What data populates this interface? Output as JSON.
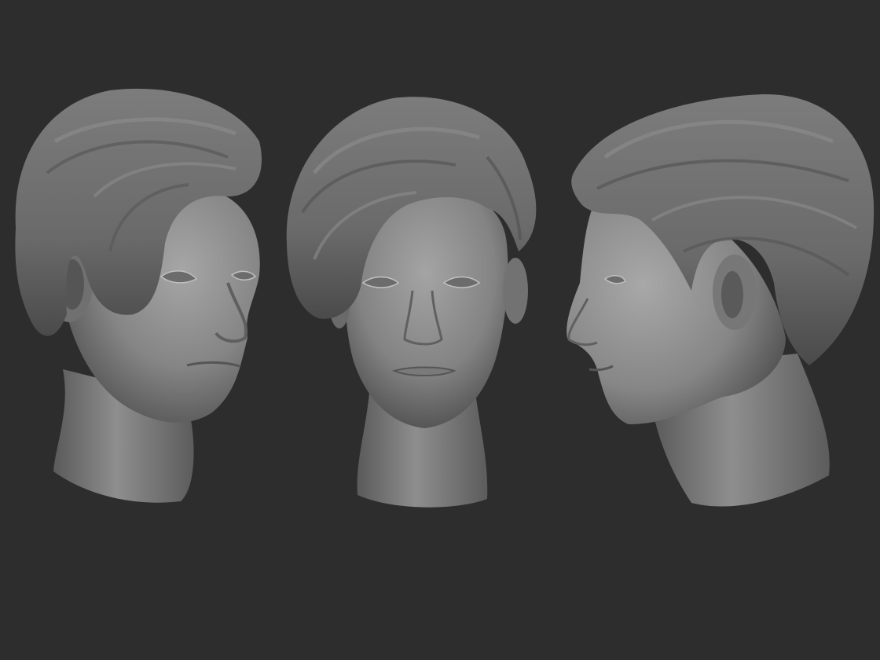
{
  "scene": {
    "background": "#2d2d2d",
    "material": "clay-gray",
    "views": [
      {
        "name": "three-quarter-view",
        "facing": "front-right"
      },
      {
        "name": "front-view",
        "facing": "front"
      },
      {
        "name": "side-profile-view",
        "facing": "left"
      }
    ]
  },
  "colors": {
    "clay_light": "#9a9a9a",
    "clay_mid": "#7a7a7a",
    "clay_dark": "#4a4a4a",
    "hair_base": "#6e6e6e"
  }
}
